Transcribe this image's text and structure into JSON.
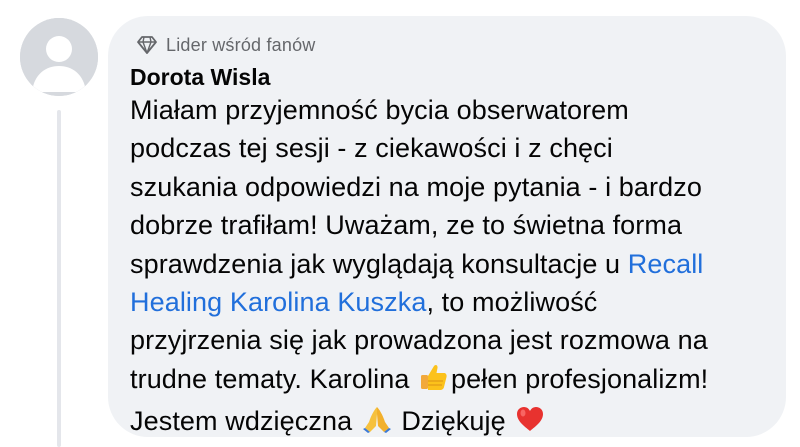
{
  "comment": {
    "badge_label": "Lider wśród fanów",
    "author": "Dorota Wisla",
    "lines": {
      "l1": "Miałam przyjemność bycia obserwatorem",
      "l2": "podczas tej sesji - z ciekawości i z chęci",
      "l3": "szukania odpowiedzi na moje pytania - i bardzo",
      "l4": "dobrze trafiłam! Uważam, ze to świetna forma",
      "l5a": "sprawdzenia jak wyglądają konsultacje u ",
      "l5link": "Recall",
      "l6link": "Healing Karolina Kuszka",
      "l6b": ", to możliwość",
      "l7": "przyjrzenia się jak prowadzona jest rozmowa na",
      "l8a": "trudne tematy. Karolina ",
      "l8b": "pełen profesjonalizm!",
      "l9a": "Jestem wdzięczna ",
      "l9b": " Dziękuję "
    },
    "icons": {
      "badge": "diamond-icon",
      "thumbs": "thumbs-up-emoji",
      "pray": "folded-hands-emoji",
      "heart": "red-heart-emoji"
    }
  },
  "colors": {
    "bubble": "#f0f2f5",
    "link": "#216fdb",
    "text": "#050505",
    "muted": "#65676b"
  }
}
